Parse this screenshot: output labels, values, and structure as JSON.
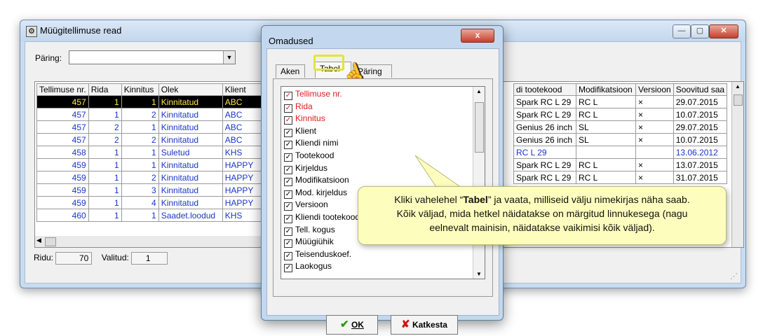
{
  "window": {
    "title": "Müügitellimuse read"
  },
  "query": {
    "label": "Päring:",
    "value": ""
  },
  "grid": {
    "headers": [
      "Tellimuse nr.",
      "Rida",
      "Kinnitus",
      "Olek",
      "Klient"
    ],
    "rows": [
      [
        "457",
        "1",
        "1",
        "Kinnitatud",
        "ABC"
      ],
      [
        "457",
        "1",
        "2",
        "Kinnitatud",
        "ABC"
      ],
      [
        "457",
        "2",
        "1",
        "Kinnitatud",
        "ABC"
      ],
      [
        "457",
        "2",
        "2",
        "Kinnitatud",
        "ABC"
      ],
      [
        "458",
        "1",
        "1",
        "Suletud",
        "KHS"
      ],
      [
        "459",
        "1",
        "1",
        "Kinnitatud",
        "HAPPY"
      ],
      [
        "459",
        "1",
        "2",
        "Kinnitatud",
        "HAPPY"
      ],
      [
        "459",
        "1",
        "3",
        "Kinnitatud",
        "HAPPY"
      ],
      [
        "459",
        "1",
        "4",
        "Kinnitatud",
        "HAPPY"
      ],
      [
        "460",
        "1",
        "1",
        "Saadet.loodud",
        "KHS"
      ]
    ],
    "right_headers": [
      "di tootekood",
      "Modifikatsioon",
      "Versioon",
      "Soovitud saa"
    ],
    "right_rows": [
      [
        "Spark RC L 29",
        "RC L",
        "×",
        "29.07.2015"
      ],
      [
        "Spark RC L 29",
        "RC L",
        "×",
        "10.07.2015"
      ],
      [
        "Genius 26 inch",
        "SL",
        "×",
        "29.07.2015"
      ],
      [
        "Genius 26 inch",
        "SL",
        "×",
        "10.07.2015"
      ],
      [
        "RC L 29",
        "",
        "",
        "13.06.2012"
      ],
      [
        "Spark RC L 29",
        "RC L",
        "×",
        "13.07.2015"
      ],
      [
        "Spark RC L 29",
        "RC L",
        "×",
        "31.07.2015"
      ]
    ]
  },
  "status": {
    "rows_label": "Ridu:",
    "rows_value": "70",
    "selected_label": "Valitud:",
    "selected_value": "1"
  },
  "dialog": {
    "title": "Omadused",
    "close": "x",
    "tabs": [
      "Aken",
      "Tabel",
      "Päring"
    ],
    "fields": [
      {
        "label": "Tellimuse nr.",
        "red": true
      },
      {
        "label": "Rida",
        "red": true
      },
      {
        "label": "Kinnitus",
        "red": true
      },
      {
        "label": "Klient",
        "red": false
      },
      {
        "label": "Kliendi nimi",
        "red": false
      },
      {
        "label": "Tootekood",
        "red": false
      },
      {
        "label": "Kirjeldus",
        "red": false
      },
      {
        "label": "Modifikatsioon",
        "red": false
      },
      {
        "label": "Mod. kirjeldus",
        "red": false
      },
      {
        "label": "Versioon",
        "red": false
      },
      {
        "label": "Kliendi tootekood",
        "red": false
      },
      {
        "label": "Tell. kogus",
        "red": false
      },
      {
        "label": "Müügiühik",
        "red": false
      },
      {
        "label": "Teisenduskoef.",
        "red": false
      },
      {
        "label": "Laokogus",
        "red": false
      }
    ],
    "ok_label": "OK",
    "cancel_label": "Katkesta"
  },
  "callout": {
    "line1_pre": "Kliki vahelehel “",
    "line1_bold": "Tabel",
    "line1_post": "” ja vaata, milliseid välju nimekirjas näha saab.",
    "line2": "Kõik väljad, mida hetkel näidatakse on märgitud linnukesega (nagu",
    "line3": "eelnevalt mainisin, näidatakse vaikimisi kõik väljad)."
  }
}
